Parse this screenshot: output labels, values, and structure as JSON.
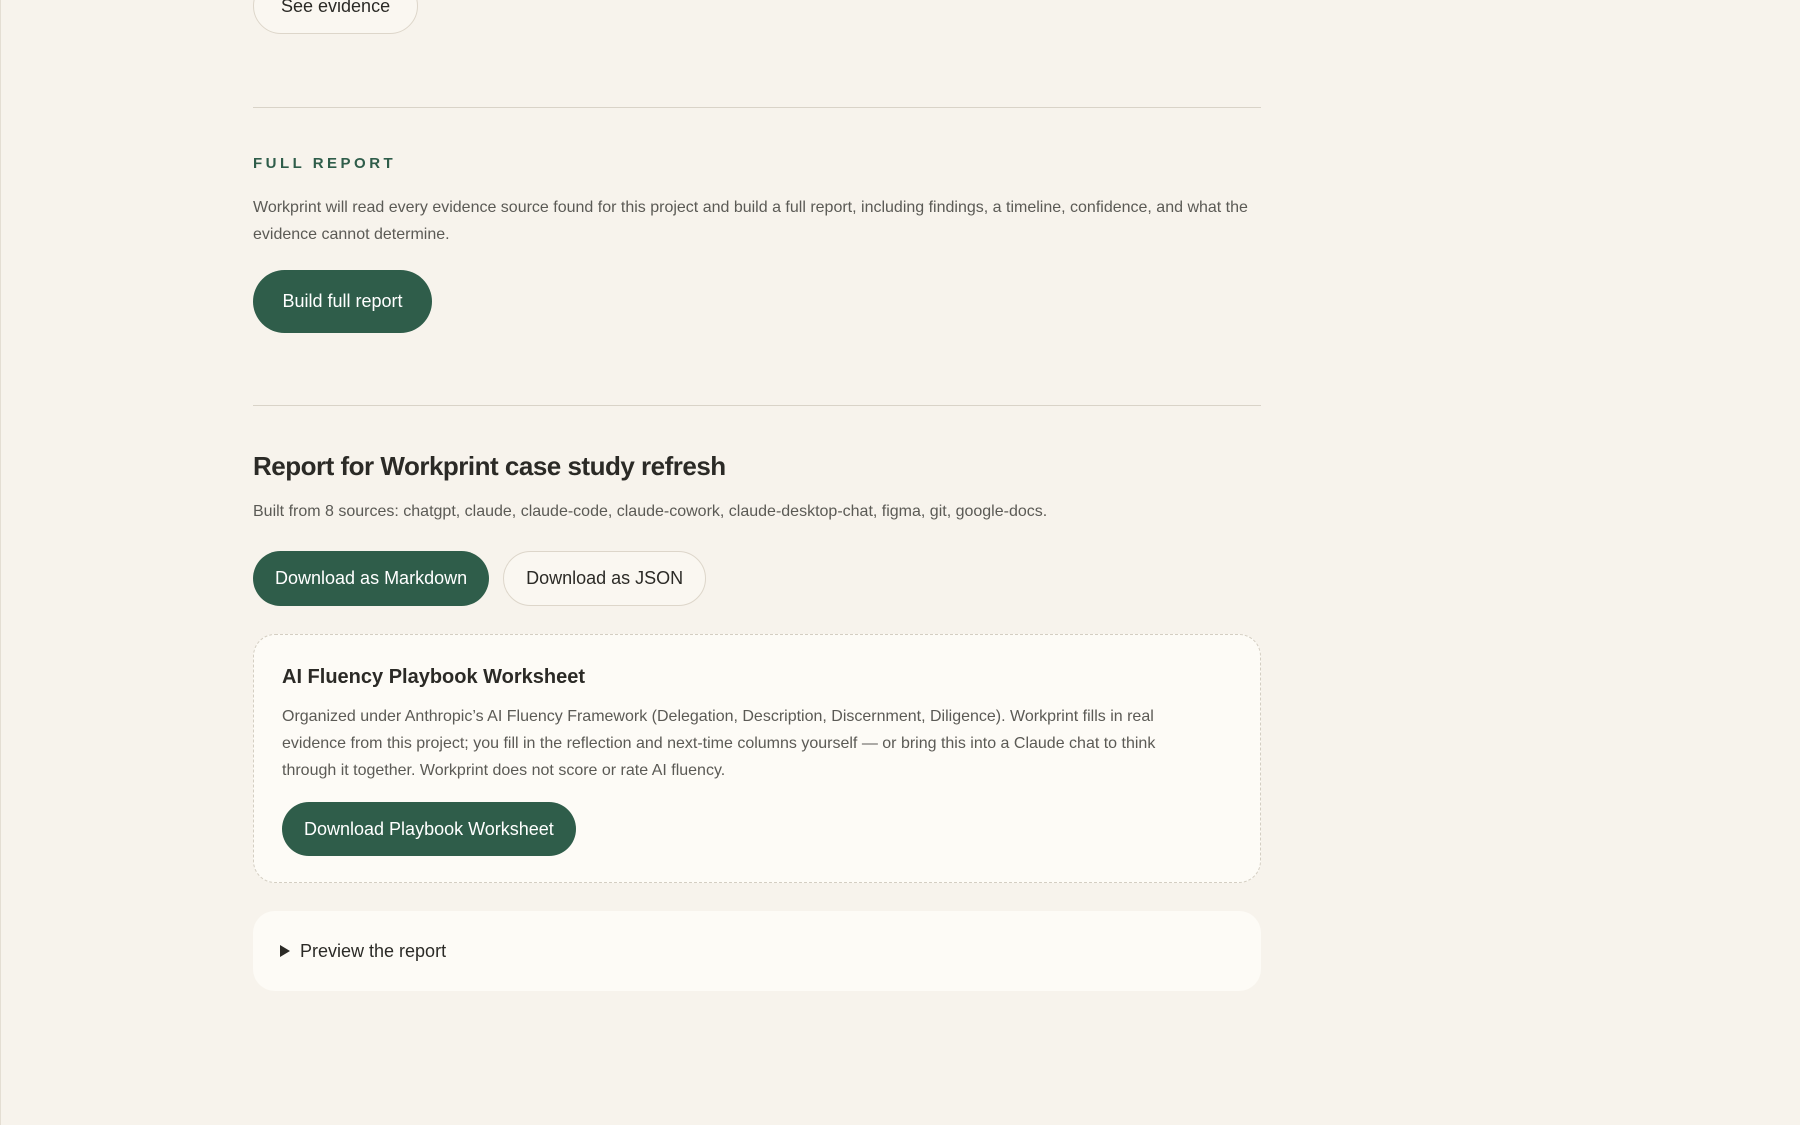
{
  "evidence": {
    "see_evidence_label": "See evidence"
  },
  "full_report": {
    "section_label": "FULL REPORT",
    "description": "Workprint will read every evidence source found for this project and build a full report, including findings, a timeline, confidence, and what the evidence cannot determine.",
    "build_label": "Build full report"
  },
  "report": {
    "title": "Report for Workprint case study refresh",
    "sources_text": "Built from 8 sources: chatgpt, claude, claude-code, claude-cowork, claude-desktop-chat, figma, git, google-docs.",
    "download_markdown_label": "Download as Markdown",
    "download_json_label": "Download as JSON"
  },
  "playbook": {
    "title": "AI Fluency Playbook Worksheet",
    "description": "Organized under Anthropic’s AI Fluency Framework (Delegation, Description, Discernment, Diligence). Workprint fills in real evidence from this project; you fill in the reflection and next-time columns yourself — or bring this into a Claude chat to think through it together. Workprint does not score or rate AI fluency.",
    "download_label": "Download Playbook Worksheet"
  },
  "preview": {
    "label": "Preview the report",
    "icon": "disclosure-triangle-right-icon"
  },
  "colors": {
    "accent": "#2f5d4a",
    "background": "#f7f3ec",
    "card": "#fdfbf6"
  }
}
